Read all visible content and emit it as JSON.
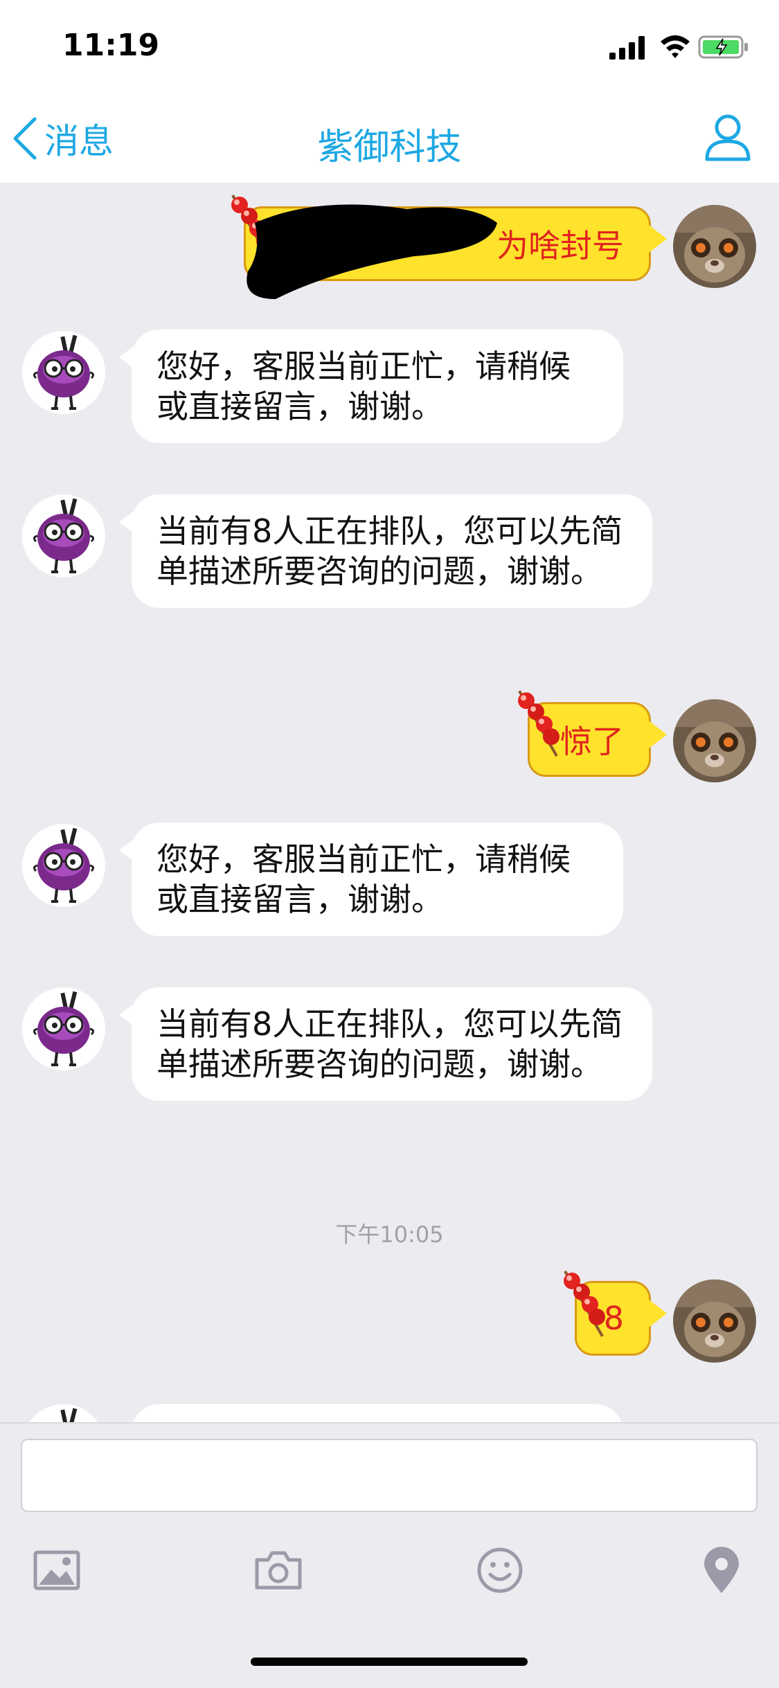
{
  "status_bar": {
    "time": "11:19"
  },
  "nav": {
    "back_label": "消息",
    "title": "紫御科技"
  },
  "messages": [
    {
      "side": "out",
      "text": "为啥封号"
    },
    {
      "side": "in",
      "text": "您好，客服当前正忙，请稍候或直接留言，谢谢。"
    },
    {
      "side": "in",
      "text": "当前有8人正在排队，您可以先简单描述所要咨询的问题，谢谢。"
    },
    {
      "side": "out",
      "text": "惊了"
    },
    {
      "side": "in",
      "text": "您好，客服当前正忙，请稍候或直接留言，谢谢。"
    },
    {
      "side": "in",
      "text": "当前有8人正在排队，您可以先简单描述所要咨询的问题，谢谢。"
    },
    {
      "side": "out",
      "text": "8"
    }
  ],
  "timestamp": "下午10:05",
  "input": {
    "value": "",
    "placeholder": ""
  },
  "toolbar": {
    "icons": [
      "image-icon",
      "camera-icon",
      "emoji-icon",
      "location-icon"
    ]
  },
  "colors": {
    "accent": "#1ea8e3",
    "outgoing_bubble": "#ffe22b",
    "outgoing_text": "#e0241e",
    "background": "#ececf0"
  }
}
